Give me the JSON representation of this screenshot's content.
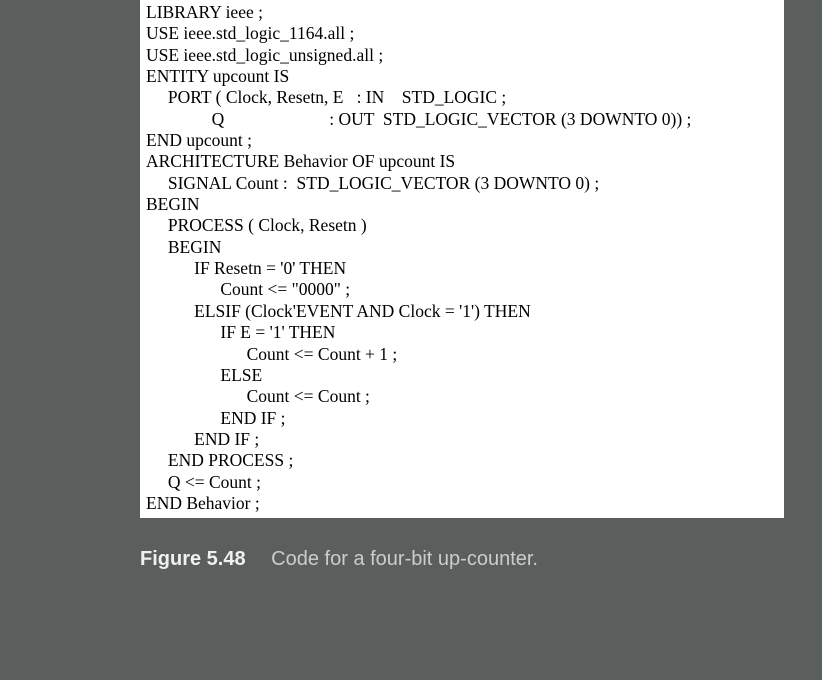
{
  "code": {
    "l01": "LIBRARY ieee ;",
    "l02": "USE ieee.std_logic_1164.all ;",
    "l03": "USE ieee.std_logic_unsigned.all ;",
    "l04": "",
    "l05": "ENTITY upcount IS",
    "l06": "     PORT ( Clock, Resetn, E   : IN    STD_LOGIC ;",
    "l07": "               Q                        : OUT  STD_LOGIC_VECTOR (3 DOWNTO 0)) ;",
    "l08": "END upcount ;",
    "l09": "",
    "l10": "ARCHITECTURE Behavior OF upcount IS",
    "l11": "     SIGNAL Count :  STD_LOGIC_VECTOR (3 DOWNTO 0) ;",
    "l12": "BEGIN",
    "l13": "     PROCESS ( Clock, Resetn )",
    "l14": "     BEGIN",
    "l15": "           IF Resetn = '0' THEN",
    "l16": "                 Count <= \"0000\" ;",
    "l17": "           ELSIF (Clock'EVENT AND Clock = '1') THEN",
    "l18": "                 IF E = '1' THEN",
    "l19": "                       Count <= Count + 1 ;",
    "l20": "                 ELSE",
    "l21": "                       Count <= Count ;",
    "l22": "                 END IF ;",
    "l23": "           END IF ;",
    "l24": "     END PROCESS ;",
    "l25": "     Q <= Count ;",
    "l26": "END Behavior ;"
  },
  "caption": {
    "label": "Figure 5.48",
    "text": "Code for a four-bit up-counter."
  }
}
